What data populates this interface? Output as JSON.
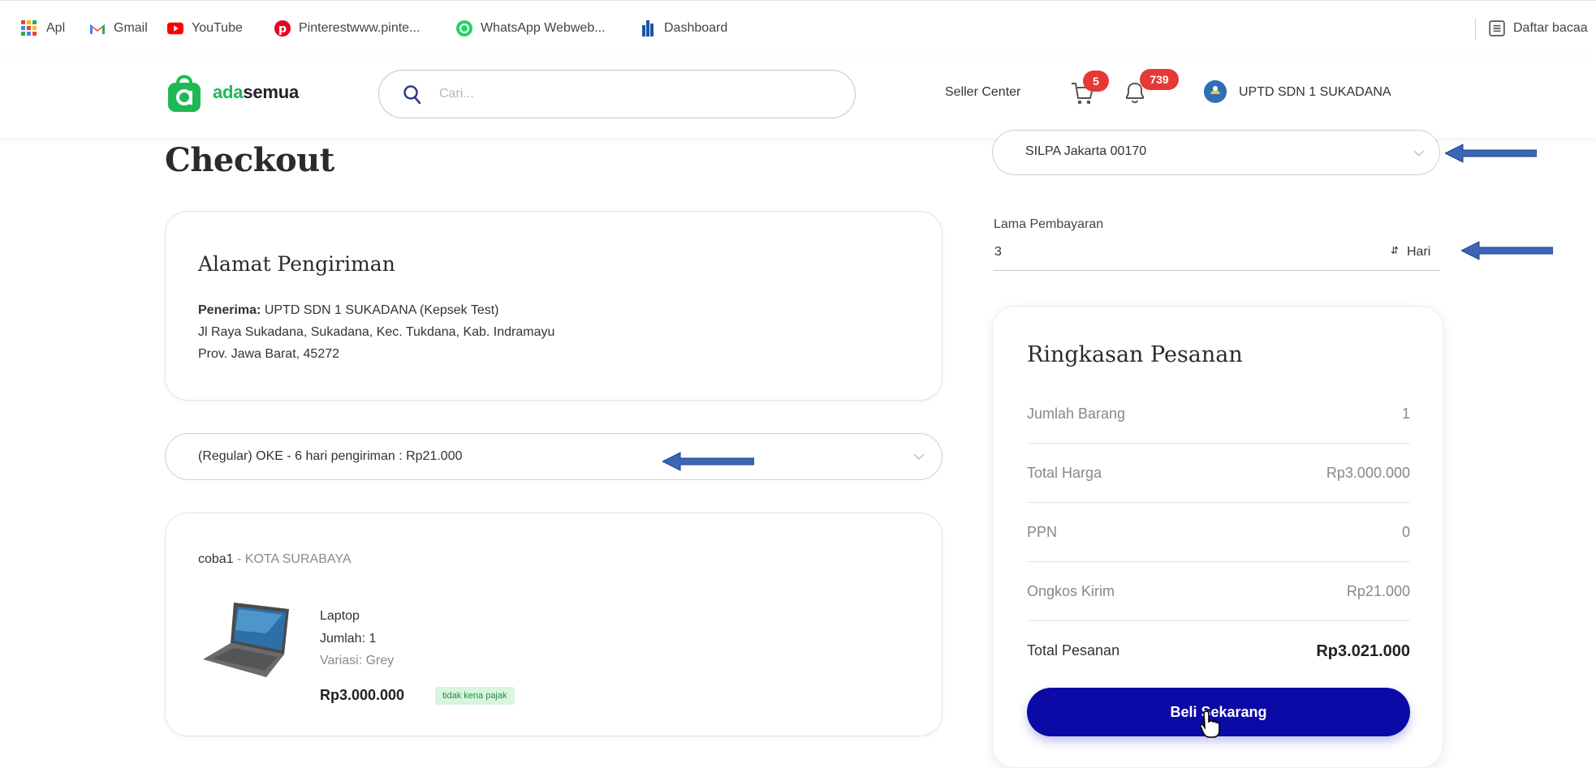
{
  "bookmarks": [
    {
      "label": "Apl",
      "icon": "apps-grid-icon"
    },
    {
      "label": "Gmail",
      "icon": "gmail-icon"
    },
    {
      "label": "YouTube",
      "icon": "youtube-icon"
    },
    {
      "label": "Pinterestwww.pinte...",
      "icon": "pinterest-icon"
    },
    {
      "label": "WhatsApp Webweb...",
      "icon": "whatsapp-icon"
    },
    {
      "label": "Dashboard",
      "icon": "dashboard-icon"
    }
  ],
  "reading_list": {
    "label": "Daftar bacaa",
    "icon": "reading-list-icon"
  },
  "header": {
    "logo_prefix": "ada",
    "logo_suffix": "semua",
    "search_placeholder": "Cari...",
    "seller_center": "Seller Center",
    "cart_count": "5",
    "notif_count": "739",
    "account_name": "UPTD SDN 1 SUKADANA"
  },
  "page": {
    "title": "Checkout"
  },
  "address": {
    "title": "Alamat Pengiriman",
    "recipient_label": "Penerima:",
    "recipient": "UPTD SDN 1 SUKADANA (Kepsek Test)",
    "street": "Jl Raya Sukadana, Sukadana, Kec. Tukdana, Kab. Indramayu",
    "province": "Prov. Jawa Barat, 45272"
  },
  "shipping": {
    "selected": "(Regular) OKE - 6 hari pengiriman : Rp21.000"
  },
  "order": {
    "seller": "coba1",
    "separator": " - ",
    "city": "KOTA SURABAYA",
    "product_name": "Laptop",
    "quantity": "Jumlah: 1",
    "variant": "Variasi: Grey",
    "price": "Rp3.000.000",
    "tax_badge": "tidak kena pajak"
  },
  "payment": {
    "account_selected": "SILPA Jakarta 00170",
    "term_label": "Lama Pembayaran",
    "term_value": "3",
    "term_unit": "Hari"
  },
  "summary": {
    "title": "Ringkasan Pesanan",
    "rows": [
      {
        "label": "Jumlah Barang",
        "value": "1"
      },
      {
        "label": "Total Harga",
        "value": "Rp3.000.000"
      },
      {
        "label": "PPN",
        "value": "0"
      },
      {
        "label": "Ongkos Kirim",
        "value": "Rp21.000"
      }
    ],
    "total_label": "Total Pesanan",
    "total_value": "Rp3.021.000",
    "buy_label": "Beli Sekarang"
  },
  "colors": {
    "brand_green": "#1db954",
    "buy_button": "#0b0aa6",
    "badge_red": "#e53935",
    "annotation_arrow": "#3a66b8"
  }
}
